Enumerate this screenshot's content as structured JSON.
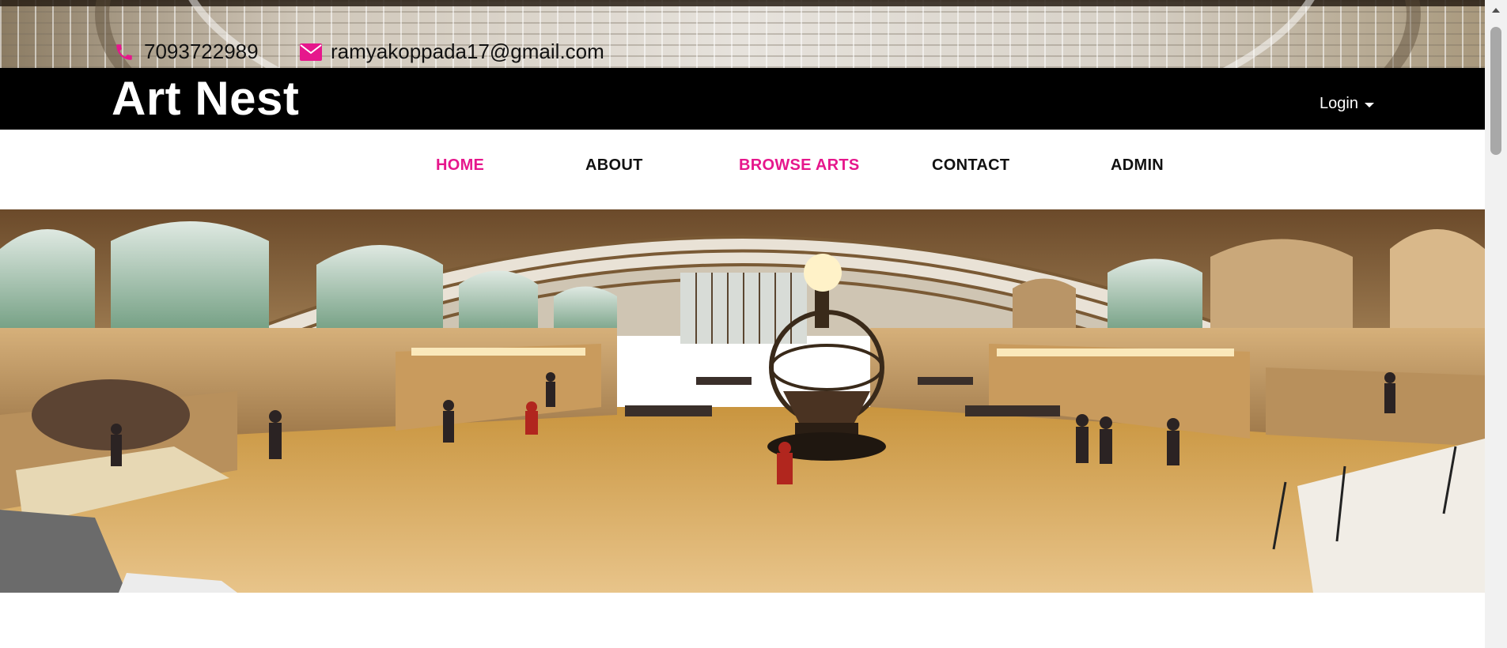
{
  "contact": {
    "phone": "7093722989",
    "email": "ramyakoppada17@gmail.com",
    "phone_icon": "phone-icon",
    "email_icon": "envelope-icon",
    "icon_color": "#e6178c"
  },
  "brand": {
    "title": "Art Nest"
  },
  "account": {
    "login_label": "Login"
  },
  "nav": {
    "items": [
      {
        "label": "HOME",
        "active": true
      },
      {
        "label": "ABOUT",
        "active": false
      },
      {
        "label": "BROWSE ARTS",
        "active": true
      },
      {
        "label": "CONTACT",
        "active": false
      },
      {
        "label": "ADMIN",
        "active": false
      }
    ],
    "active_color": "#e6178c"
  },
  "hero": {
    "image": "museum-gallery-hall"
  }
}
